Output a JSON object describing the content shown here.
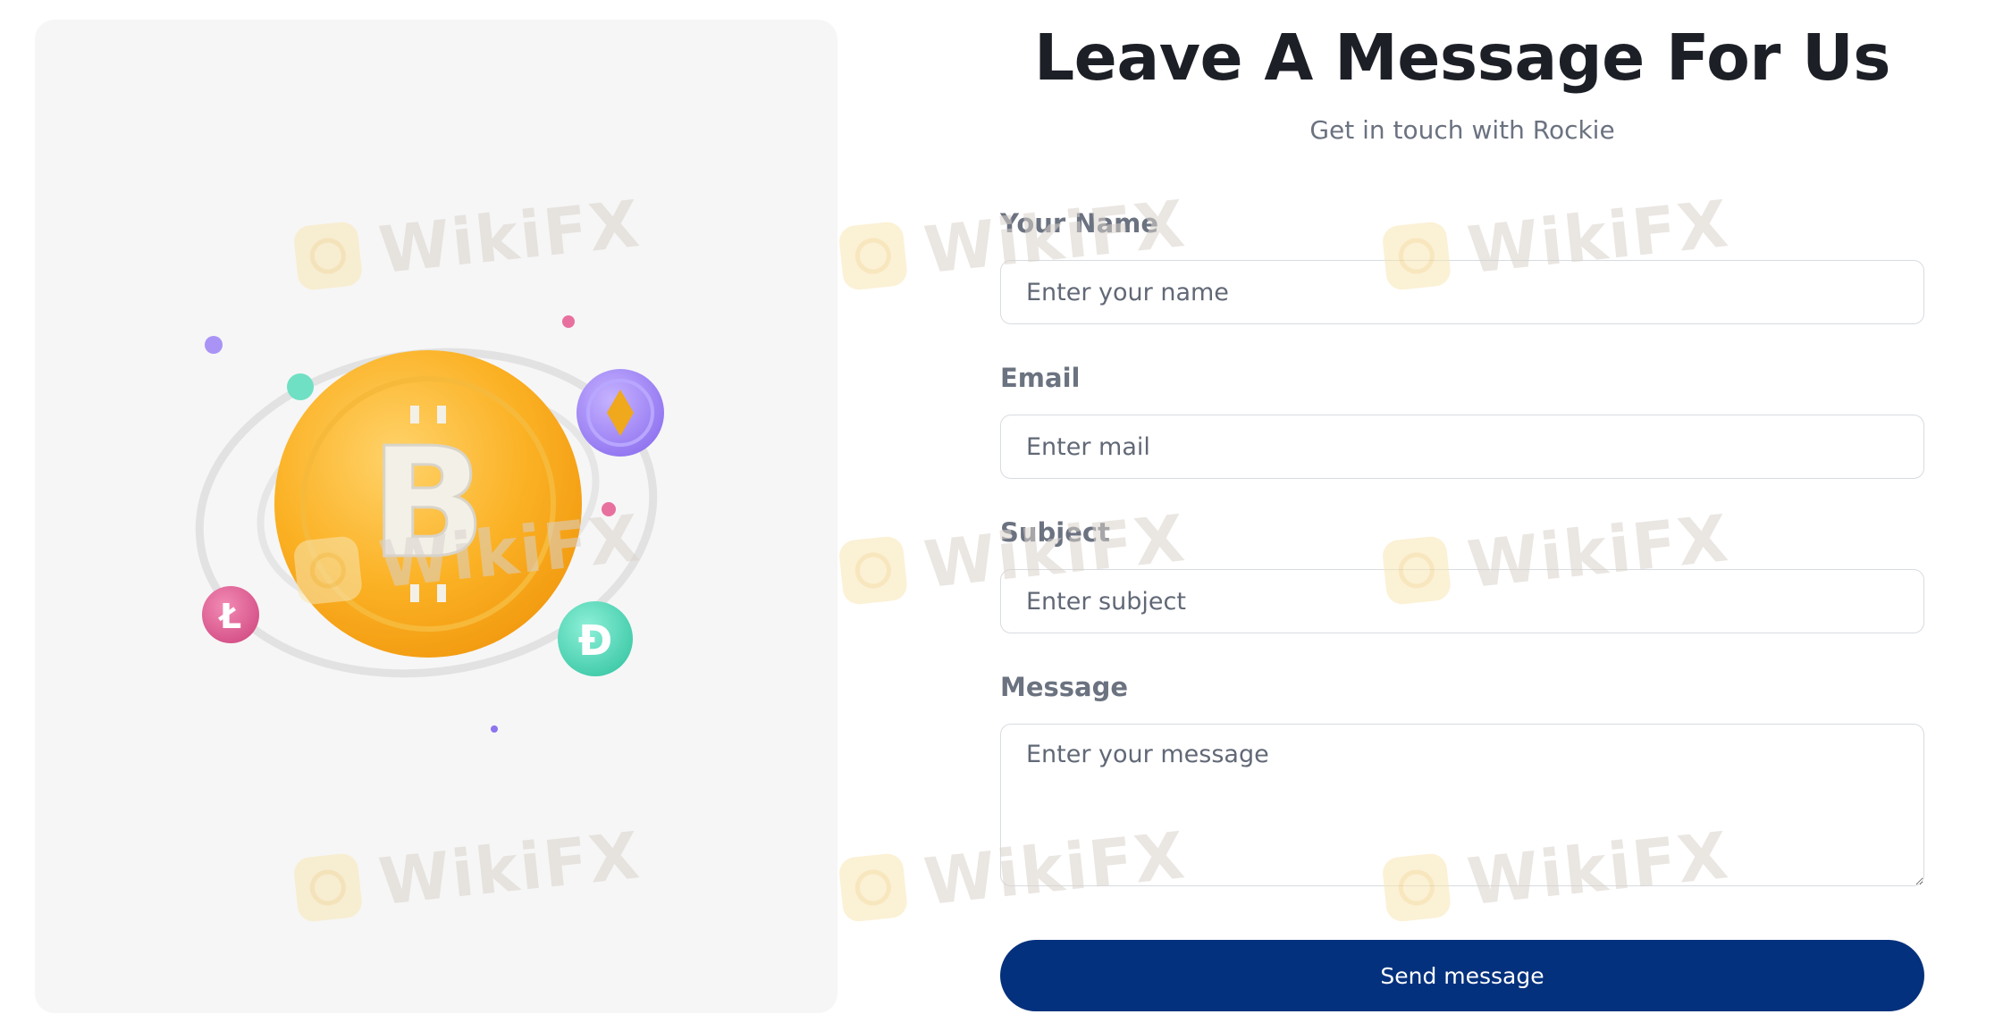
{
  "header": {
    "title": "Leave A Message For Us",
    "subtitle": "Get in touch with Rockie"
  },
  "form": {
    "name": {
      "label": "Your Name",
      "placeholder": "Enter your name"
    },
    "email": {
      "label": "Email",
      "placeholder": "Enter mail"
    },
    "subject": {
      "label": "Subject",
      "placeholder": "Enter subject"
    },
    "message": {
      "label": "Message",
      "placeholder": "Enter your message"
    },
    "submit_label": "Send message"
  },
  "illustration": {
    "coin_symbols": {
      "main": "B",
      "left": "Ł",
      "right": "Đ"
    }
  },
  "watermark": {
    "text": "WikiFX"
  },
  "colors": {
    "primary_button": "#04317d",
    "coin_gold": "#fbb124",
    "coin_purple": "#a78bfa",
    "coin_pink": "#e0679a",
    "coin_teal": "#5fdcc0"
  }
}
